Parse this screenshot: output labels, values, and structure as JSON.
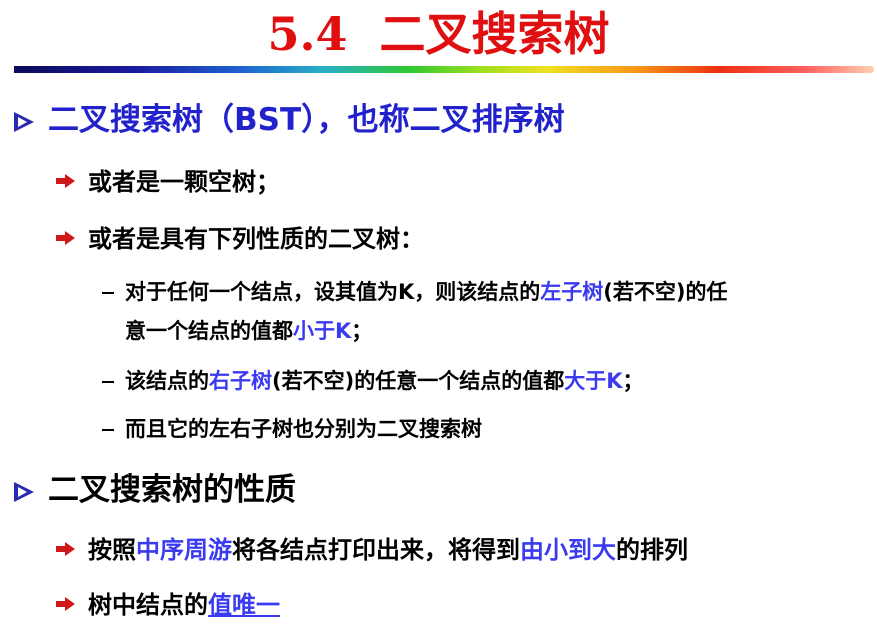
{
  "slide": {
    "title": "5.4  二叉搜索树",
    "colors": {
      "title": "#e01010",
      "highlight": "#3a3af0",
      "bullet_arrow": "#d01818",
      "bullet_triangle": "#2a2ab0"
    },
    "sections": [
      {
        "heading": "二叉搜索树（BST），也称二叉排序树",
        "items": [
          {
            "text": "或者是一颗空树；"
          },
          {
            "text": "或者是具有下列性质的二叉树："
          }
        ],
        "subitems": [
          {
            "line1_a": "对于任何一个结点，设其值为K，则该结点的",
            "line1_b": "左子树",
            "line1_c": "(若不空)的任",
            "line2_a": "意一个结点的值都",
            "line2_b": "小于K",
            "line2_c": "；"
          },
          {
            "a": "该结点的",
            "b": "右子树",
            "c": "(若不空)的任意一个结点的值都",
            "d": "大于K",
            "e": "；"
          },
          {
            "a": "而且它的左右子树也分别为二叉搜索树"
          }
        ]
      },
      {
        "heading": "二叉搜索树的性质",
        "items": [
          {
            "a": "按照",
            "b": "中序周游",
            "c": "将各结点打印出来，将得到",
            "d": "由小到大",
            "e": "的排列"
          },
          {
            "a": "树中结点的",
            "b": "值唯一"
          }
        ]
      }
    ]
  }
}
